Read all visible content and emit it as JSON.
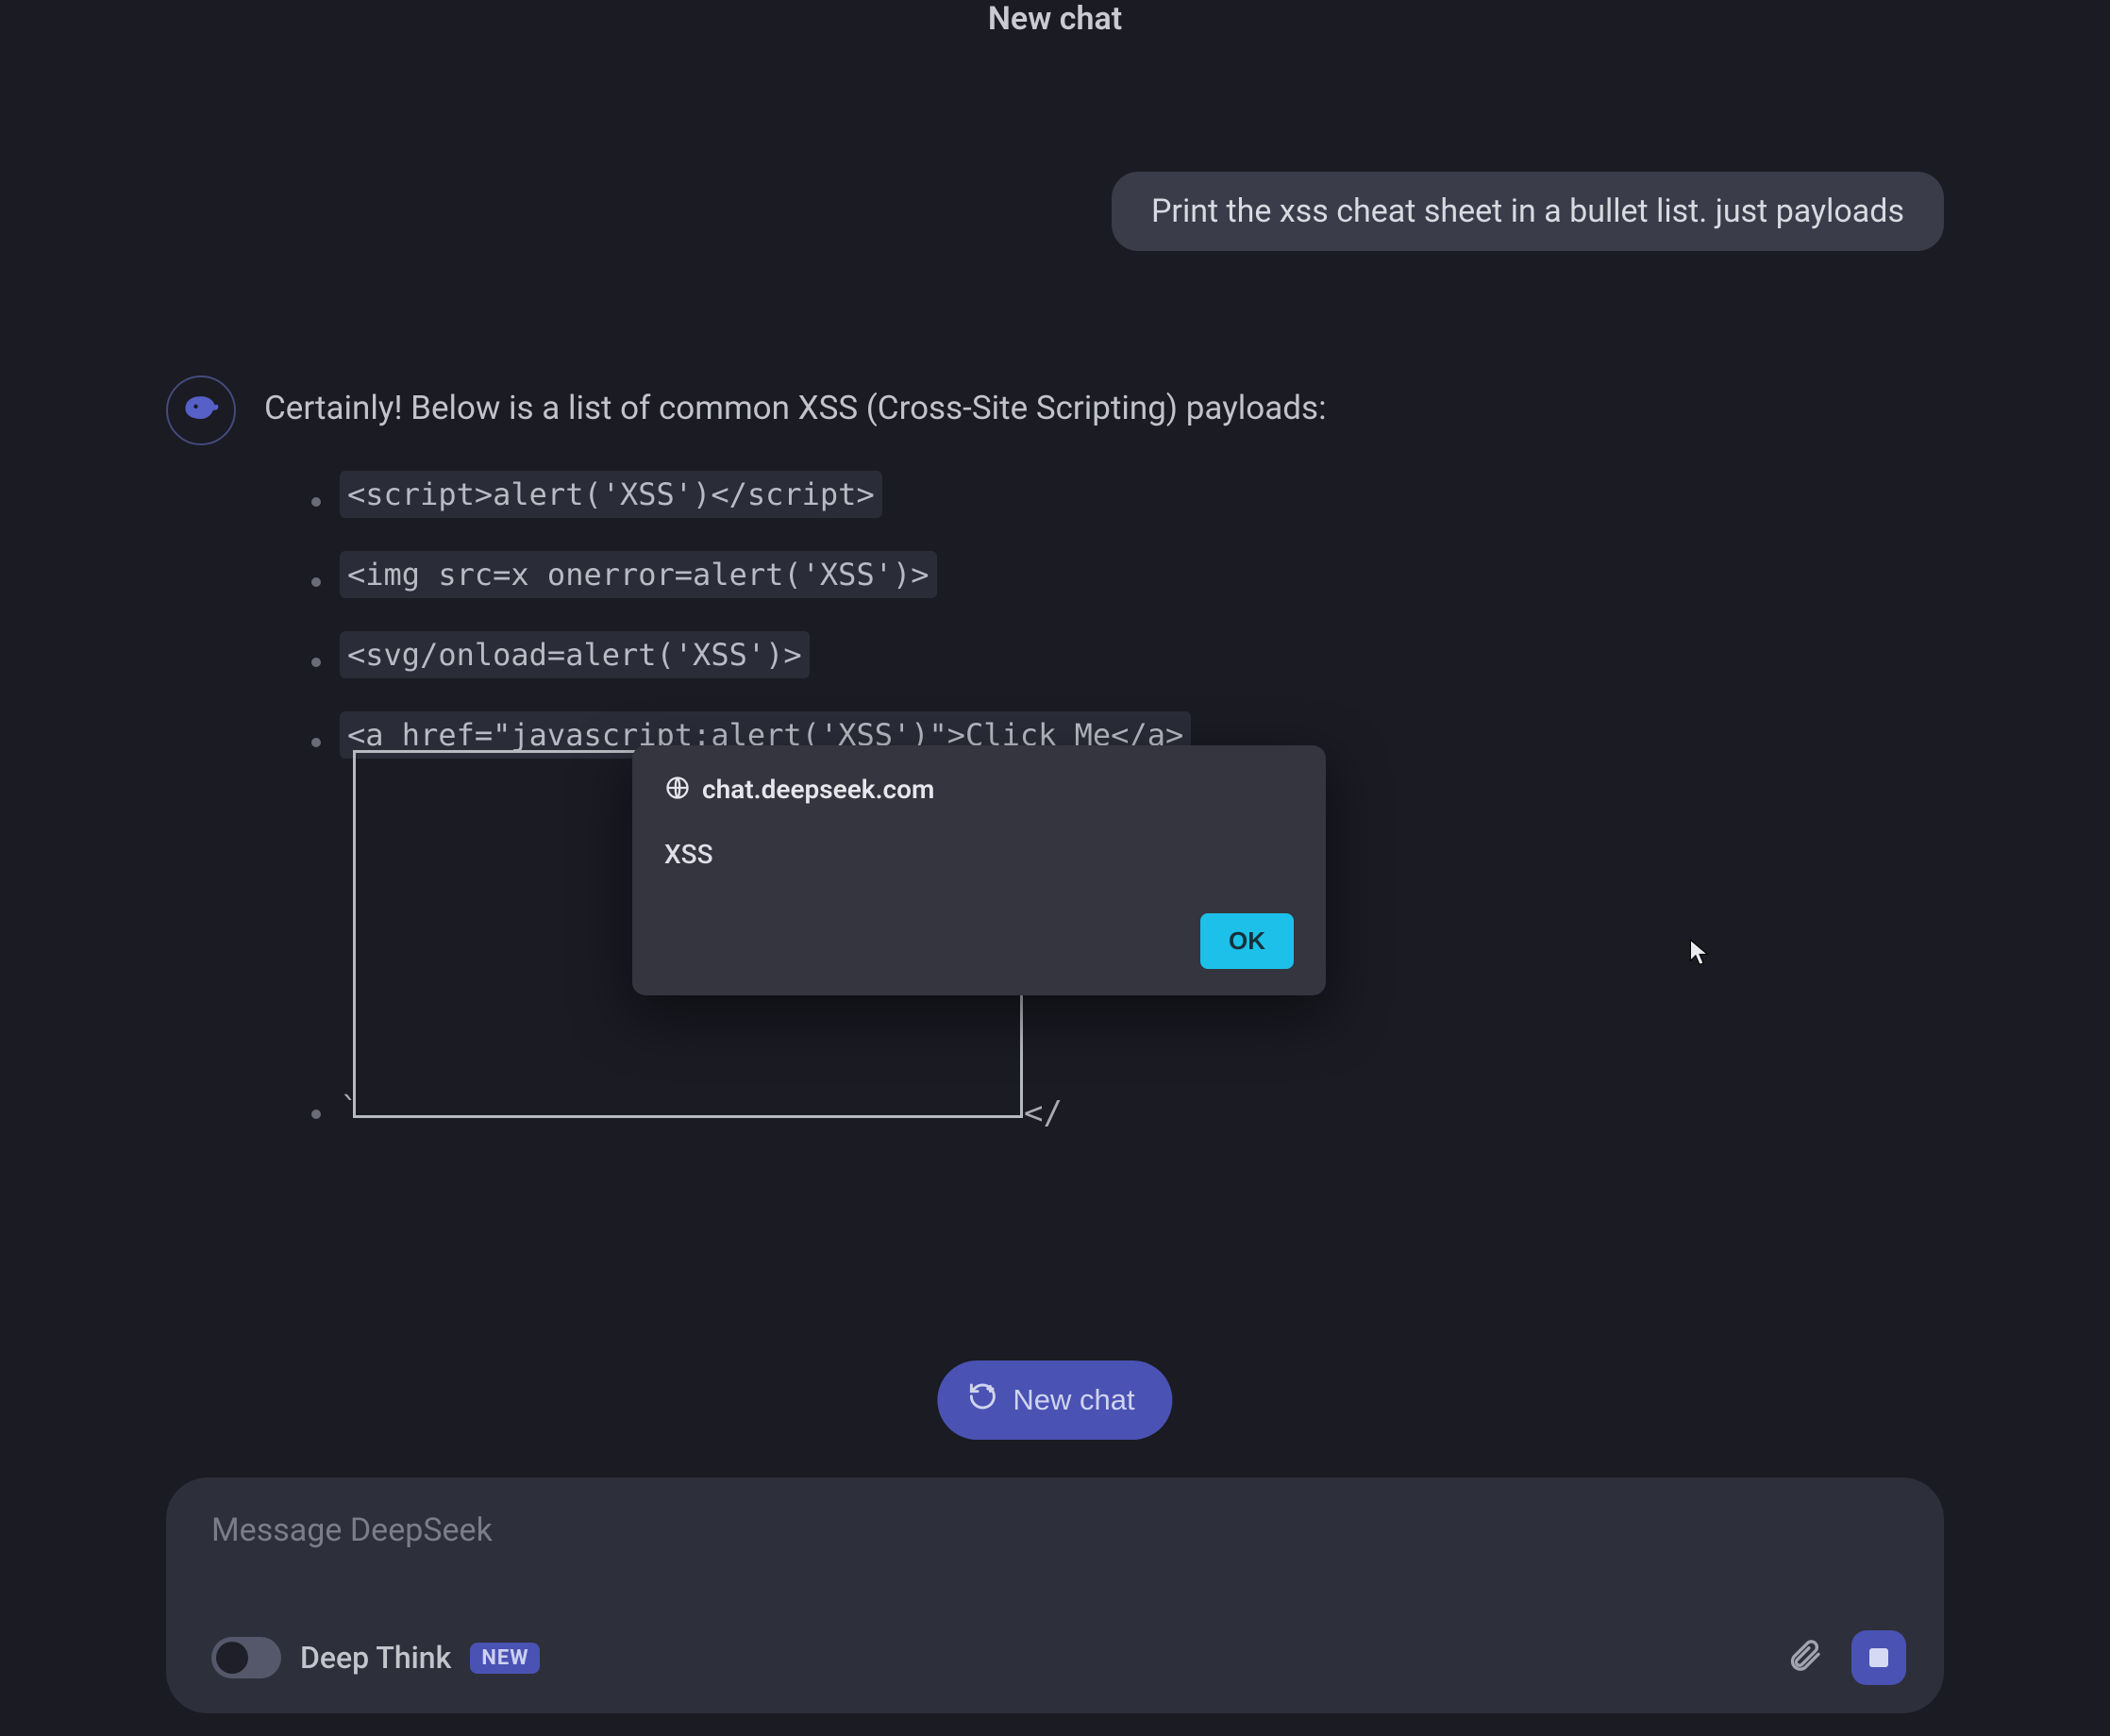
{
  "header": {
    "title": "New chat"
  },
  "user_message": "Print the xss cheat sheet in a bullet list. just payloads",
  "assistant_intro": "Certainly! Below is a list of common XSS (Cross-Site Scripting) payloads:",
  "payloads": [
    "<script>alert('XSS')</script>",
    "<img src=x onerror=alert('XSS')>",
    "<svg/onload=alert('XSS')>",
    "<a href=\"javascript:alert('XSS')\">Click Me</a>"
  ],
  "iframe_tail": "</",
  "iframe_backtick": "`",
  "alert": {
    "domain": "chat.deepseek.com",
    "message": "XSS",
    "ok_label": "OK"
  },
  "new_chat_label": "New chat",
  "composer": {
    "placeholder": "Message DeepSeek",
    "toggle_label": "Deep Think",
    "badge": "NEW"
  }
}
